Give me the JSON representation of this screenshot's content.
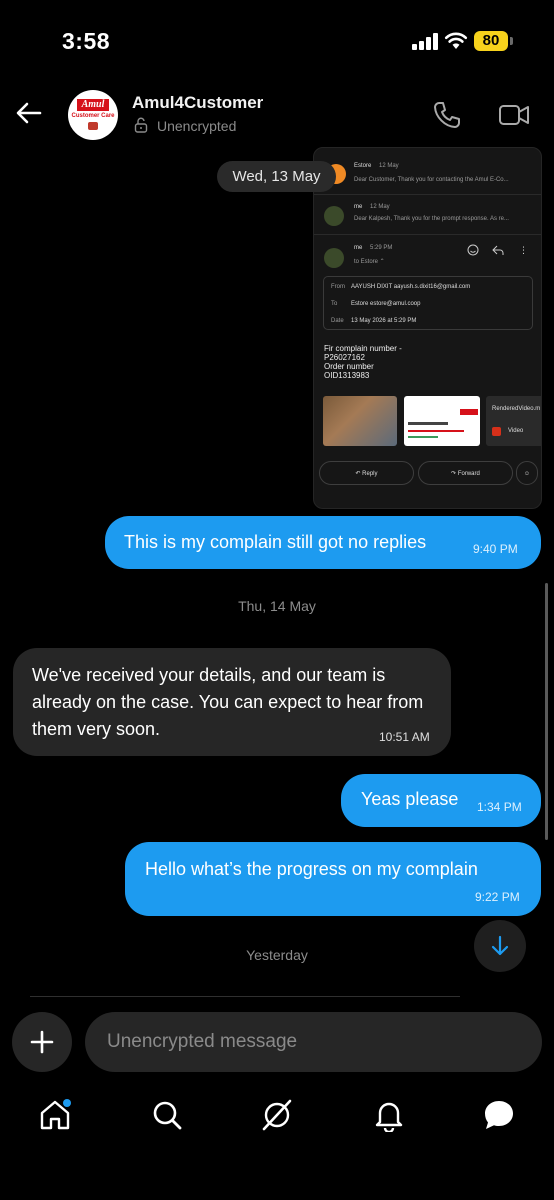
{
  "status_bar": {
    "time": "3:58",
    "battery": "80"
  },
  "header": {
    "contact_name": "Amul4Customer",
    "encryption_status": "Unencrypted",
    "avatar_brand": "Amul",
    "avatar_subtitle": "Customer Care"
  },
  "shared_image": {
    "estore_sender": "Estore",
    "estore_date": "12 May",
    "estore_preview": "Dear Customer, Thank you for contacting the Amul E-Co...",
    "me1_sender": "me",
    "me1_date": "12 May",
    "me1_preview": "Dear Kalpesh, Thank you for the prompt response. As re...",
    "me2_sender": "me",
    "me2_time": "5:29 PM",
    "me2_to": "to Estore ⌃",
    "from_label": "From",
    "from_value": "AAYUSH DIXIT   aayush.s.dixit16@gmail.com",
    "to_label": "To",
    "to_value": "Estore   estore@amul.coop",
    "date_label": "Date",
    "date_value": "13 May 2026 at 5:29 PM",
    "body_lines": [
      "Fir complain number -",
      "P26027162",
      "Order number",
      "OID1313983"
    ],
    "attachment_video_name": "RenderedVideo.m",
    "attachment_video_type": "Video",
    "reply_label": "Reply",
    "forward_label": "Forward"
  },
  "floating_date": "Wed, 13 May",
  "messages": [
    {
      "direction": "out",
      "text": "This is my complain still got no replies",
      "time": "9:40 PM"
    },
    {
      "direction": "in",
      "text": "We've received your details, and our team is already on the case. You can expect to hear from them very soon.",
      "time": "10:51 AM"
    },
    {
      "direction": "out",
      "text": "Yeas please",
      "time": "1:34 PM"
    },
    {
      "direction": "out",
      "text": "Hello what’s the progress on my complain",
      "time": "9:22 PM"
    }
  ],
  "date_separators": [
    "Thu, 14 May",
    "Yesterday"
  ],
  "composer": {
    "placeholder": "Unencrypted message"
  },
  "colors": {
    "outgoing_bubble": "#1d9bf0",
    "incoming_bubble": "#262626",
    "background": "#000000",
    "battery": "#f7d21c",
    "notification_dot": "#1d9bf0"
  },
  "tabs": [
    "home-icon",
    "search-icon",
    "grok-icon",
    "bell-icon",
    "messages-icon"
  ]
}
